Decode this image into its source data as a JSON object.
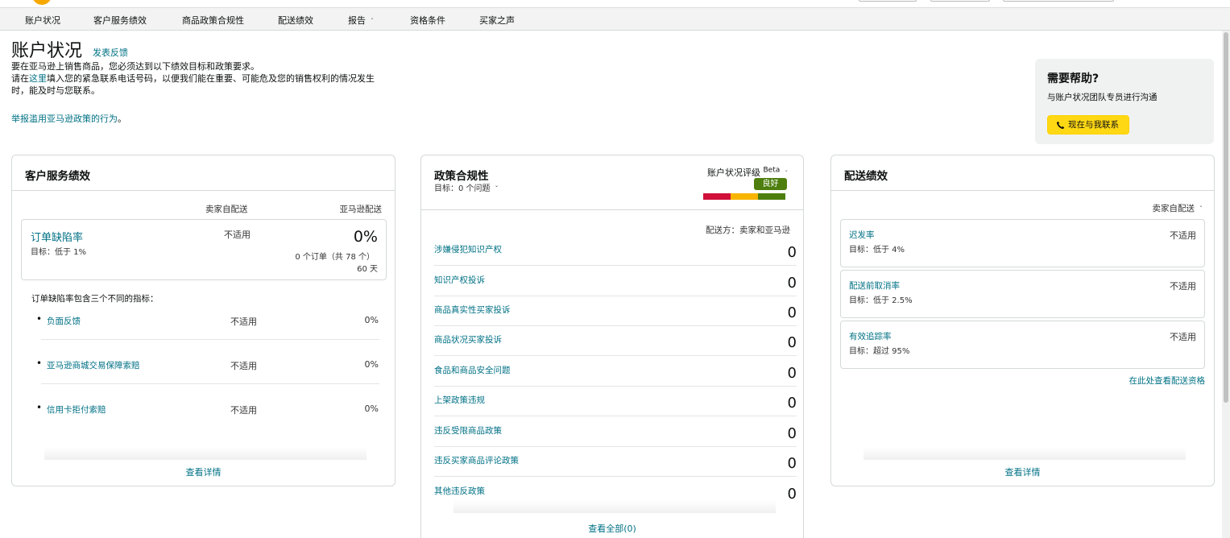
{
  "nav": {
    "items": [
      {
        "label": "账户状况"
      },
      {
        "label": "客户服务绩效"
      },
      {
        "label": "商品政策合规性"
      },
      {
        "label": "配送绩效"
      },
      {
        "label": "报告"
      },
      {
        "label": "资格条件"
      },
      {
        "label": "买家之声"
      }
    ]
  },
  "header": {
    "title": "账户状况",
    "feedback_link": "发表反馈",
    "intro_line1": "要在亚马逊上销售商品，您必须达到以下绩效目标和政策要求。",
    "intro_line2_prefix": "请在",
    "intro_line2_link": "这里",
    "intro_line2_suffix": "填入您的紧急联系电话号码，以便我们能在重要、可能危及您的销售权利的情况发生时，能及时与您联系。",
    "report_link": "举报滥用亚马逊政策的行为",
    "report_suffix": "。"
  },
  "help": {
    "title": "需要帮助?",
    "subtitle": "与账户状况团队专员进行沟通",
    "button": "现在与我联系"
  },
  "customer_service": {
    "title": "客户服务绩效",
    "col_seller": "卖家自配送",
    "col_amazon": "亚马逊配送",
    "odr_label": "订单缺陷率",
    "odr_target": "目标：低于 1%",
    "odr_seller": "不适用",
    "odr_amazon": "0%",
    "odr_orders": "0 个订单（共 78 个）",
    "odr_days": "60 天",
    "metrics_intro": "订单缺陷率包含三个不同的指标：",
    "metrics": [
      {
        "label": "负面反馈",
        "seller": "不适用",
        "amazon": "0%"
      },
      {
        "label": "亚马逊商城交易保障索赔",
        "seller": "不适用",
        "amazon": "0%"
      },
      {
        "label": "信用卡拒付索赔",
        "seller": "不适用",
        "amazon": "0%"
      }
    ],
    "details_link": "查看详情"
  },
  "policy": {
    "title": "政策合规性",
    "target": "目标：0 个问题",
    "rating_label": "账户状况评级",
    "beta": "Beta",
    "rating_badge": "良好",
    "shipped_by": "配送方：卖家和亚马逊",
    "rows": [
      {
        "label": "涉嫌侵犯知识产权",
        "value": "0"
      },
      {
        "label": "知识产权投诉",
        "value": "0"
      },
      {
        "label": "商品真实性买家投诉",
        "value": "0"
      },
      {
        "label": "商品状况买家投诉",
        "value": "0"
      },
      {
        "label": "食品和商品安全问题",
        "value": "0"
      },
      {
        "label": "上架政策违规",
        "value": "0"
      },
      {
        "label": "违反受限商品政策",
        "value": "0"
      },
      {
        "label": "违反买家商品评论政策",
        "value": "0"
      },
      {
        "label": "其他违反政策",
        "value": "0"
      }
    ],
    "view_all": "查看全部(0)",
    "colors": {
      "bad": "#d0103a",
      "fair": "#f7b500",
      "good": "#4e7f0e"
    }
  },
  "delivery": {
    "title": "配送绩效",
    "selector": "卖家自配送",
    "rows": [
      {
        "label": "迟发率",
        "target": "目标：低于 4%",
        "value": "不适用"
      },
      {
        "label": "配送前取消率",
        "target": "目标：低于 2.5%",
        "value": "不适用"
      },
      {
        "label": "有效追踪率",
        "target": "目标：超过 95%",
        "value": "不适用"
      }
    ],
    "eligibility_link": "在此处查看配送资格",
    "details_link": "查看详情"
  }
}
